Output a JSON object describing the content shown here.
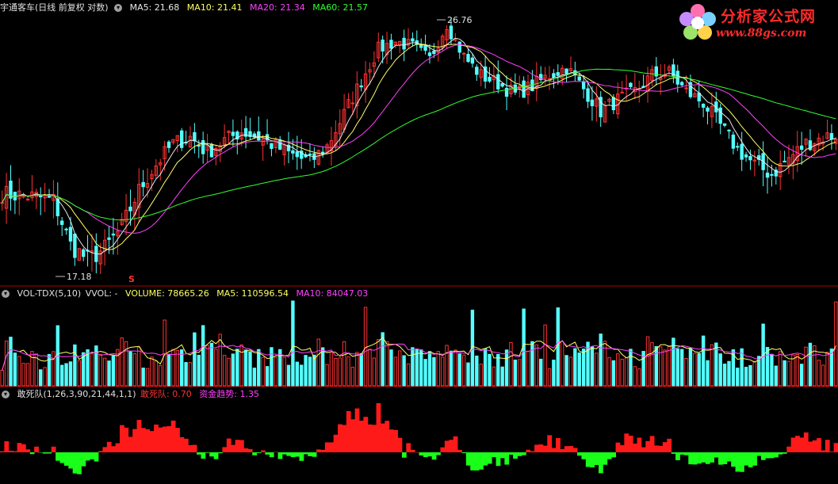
{
  "colors": {
    "bg": "#000000",
    "up": "#ff3232",
    "down": "#54ffff",
    "ma5": "#e8e8e8",
    "ma10": "#ffff66",
    "ma20": "#ff40ff",
    "ma60": "#30ff30",
    "divider": "#b00000",
    "pos": "#ff1a1a",
    "neg": "#1aff1a"
  },
  "price_panel": {
    "title": "宇通客车(日线 前复权 对数)",
    "ma5": "MA5: 21.68",
    "ma10": "MA10: 21.41",
    "ma20": "MA20: 21.34",
    "ma60": "MA60: 21.57",
    "high_label": "26.76",
    "low_label": "17.18",
    "marker": "S"
  },
  "volume_panel": {
    "title": "VOL-TDX(5,10)",
    "vvol": "VVOL: -",
    "volume": "VOLUME: 78665.26",
    "ma5": "MA5: 110596.54",
    "ma10": "MA10: 84047.03"
  },
  "indicator_panel": {
    "title": "敢死队(1,26,3,90,21,44,1,1)",
    "gsd": "敢死队: 0.70",
    "fund": "资金趋势: 1.35"
  },
  "logo": {
    "name": "分析家公式网",
    "url": "www.88gs.com",
    "icon": "flower-logo-icon"
  },
  "chart_data": {
    "type": "candlestick",
    "price_range": [
      17.18,
      26.76
    ],
    "high": 26.76,
    "low": 17.18,
    "close_anchors": [
      [
        0,
        19.8
      ],
      [
        8,
        19.7
      ],
      [
        12,
        19.6
      ],
      [
        16,
        18.3
      ],
      [
        20,
        17.9
      ],
      [
        24,
        18.2
      ],
      [
        28,
        18.8
      ],
      [
        32,
        19.9
      ],
      [
        36,
        20.7
      ],
      [
        40,
        21.4
      ],
      [
        44,
        21.6
      ],
      [
        48,
        21.1
      ],
      [
        52,
        21.5
      ],
      [
        56,
        21.8
      ],
      [
        60,
        21.6
      ],
      [
        64,
        21.3
      ],
      [
        68,
        21.0
      ],
      [
        72,
        20.8
      ],
      [
        76,
        21.3
      ],
      [
        80,
        22.4
      ],
      [
        84,
        23.6
      ],
      [
        88,
        24.8
      ],
      [
        92,
        25.1
      ],
      [
        96,
        24.9
      ],
      [
        100,
        24.4
      ],
      [
        104,
        25.8
      ],
      [
        108,
        24.5
      ],
      [
        112,
        23.8
      ],
      [
        116,
        23.5
      ],
      [
        120,
        23.1
      ],
      [
        124,
        23.4
      ],
      [
        128,
        23.8
      ],
      [
        132,
        24.1
      ],
      [
        136,
        23.3
      ],
      [
        140,
        22.5
      ],
      [
        144,
        22.9
      ],
      [
        148,
        23.2
      ],
      [
        152,
        23.8
      ],
      [
        156,
        23.9
      ],
      [
        160,
        23.2
      ],
      [
        164,
        22.8
      ],
      [
        168,
        22.0
      ],
      [
        172,
        21.2
      ],
      [
        176,
        20.7
      ],
      [
        180,
        20.4
      ],
      [
        184,
        20.9
      ],
      [
        188,
        21.4
      ],
      [
        192,
        21.6
      ],
      [
        195,
        21.68
      ]
    ],
    "series": [
      {
        "name": "MA5",
        "value": 21.68
      },
      {
        "name": "MA10",
        "value": 21.41
      },
      {
        "name": "MA20",
        "value": 21.34
      },
      {
        "name": "MA60",
        "value": 21.57
      }
    ],
    "volume": {
      "last": 78665.26,
      "ma5": 110596.54,
      "ma10": 84047.03
    },
    "indicator": {
      "gsd": 0.7,
      "fund_trend": 1.35
    }
  }
}
